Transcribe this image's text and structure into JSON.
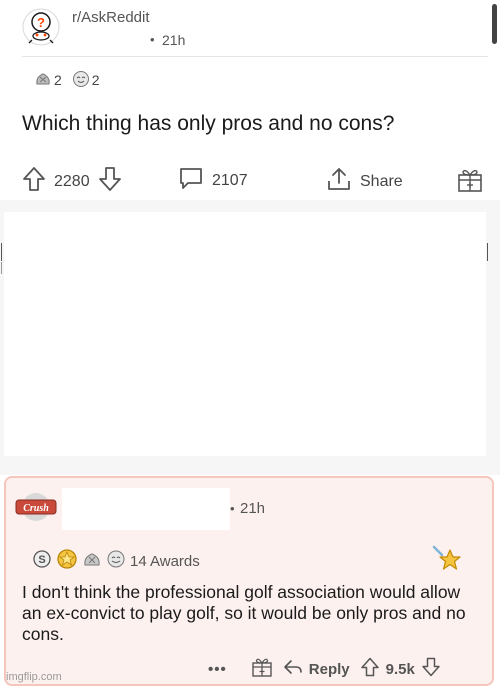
{
  "post": {
    "subreddit": "r/AskReddit",
    "time": "21h",
    "dot": "•",
    "awards": [
      {
        "icon": "silver-bag-award-icon",
        "count": "2"
      },
      {
        "icon": "wholesome-award-icon",
        "count": "2"
      }
    ],
    "title": "Which thing has only pros and no cons?",
    "upvotes": "2280",
    "comments": "2107",
    "share_label": "Share"
  },
  "comment": {
    "dot": "•",
    "time": "21h",
    "awards_label": "14 Awards",
    "award_icons": [
      "silver-award-icon",
      "gold-award-icon",
      "bag-award-icon",
      "wholesome-award-icon"
    ],
    "avatar_text": "Crush",
    "body": "I don't think the professional golf association would allow an ex-convict to play golf, so it would be only pros and no cons.",
    "more_label": "•••",
    "reply_label": "Reply",
    "score": "9.5k"
  },
  "watermark": "imgflip.com",
  "colors": {
    "highlight_bg": "#fdf1ef",
    "highlight_border": "#f6c6bd",
    "text": "#1a1a1b",
    "muted": "#555555"
  }
}
